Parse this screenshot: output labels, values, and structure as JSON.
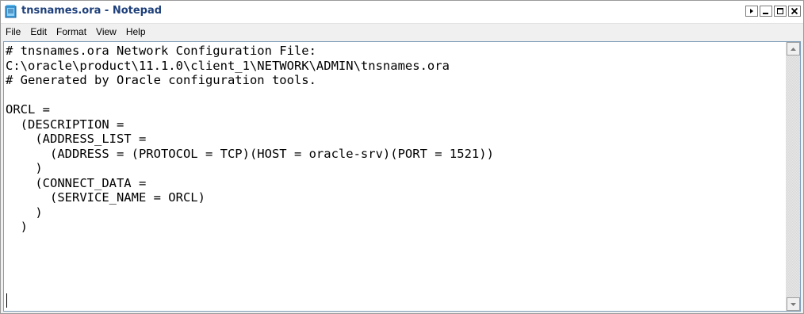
{
  "window": {
    "title": "tnsnames.ora - Notepad"
  },
  "titlebar_buttons": [
    {
      "name": "restore-arrow-button",
      "icon": "small-right-arrow-icon"
    },
    {
      "name": "minimize-button",
      "icon": "minimize-icon"
    },
    {
      "name": "maximize-button",
      "icon": "maximize-icon"
    },
    {
      "name": "close-button",
      "icon": "close-icon"
    }
  ],
  "menu": {
    "items": [
      "File",
      "Edit",
      "Format",
      "View",
      "Help"
    ]
  },
  "editor": {
    "lines": [
      "# tnsnames.ora Network Configuration File:",
      "C:\\oracle\\product\\11.1.0\\client_1\\NETWORK\\ADMIN\\tnsnames.ora",
      "# Generated by Oracle configuration tools.",
      "",
      "ORCL =",
      "  (DESCRIPTION =",
      "    (ADDRESS_LIST =",
      "      (ADDRESS = (PROTOCOL = TCP)(HOST = oracle-srv)(PORT = 1521))",
      "    )",
      "    (CONNECT_DATA =",
      "      (SERVICE_NAME = ORCL)",
      "    )",
      "  )",
      ""
    ]
  },
  "colors": {
    "title_text": "#1d3f7a",
    "editor_border": "#7f9db9",
    "window_bg": "#f0f0f0"
  }
}
